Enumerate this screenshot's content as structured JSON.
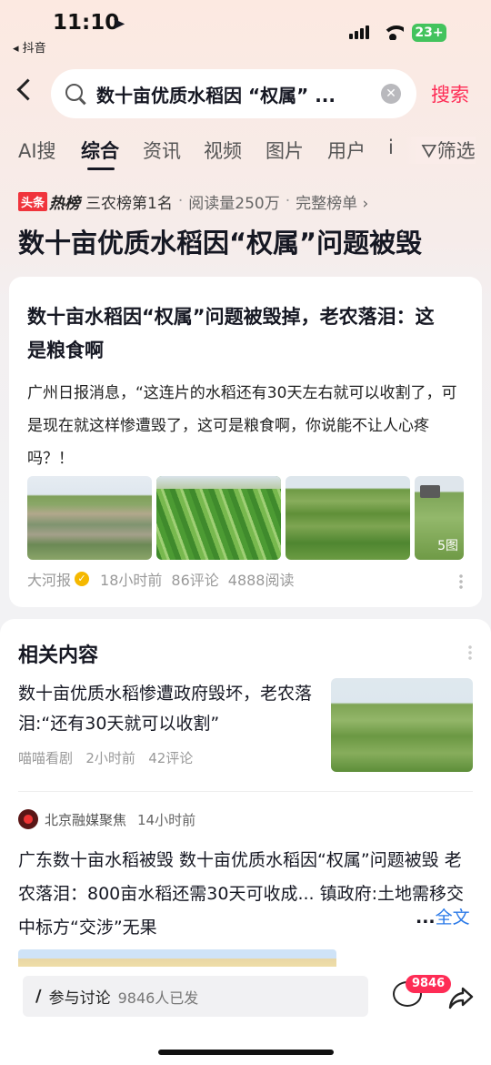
{
  "status": {
    "time": "11:10",
    "back_app": "◂ 抖音",
    "battery": "23+"
  },
  "search": {
    "query": "数十亩优质水稻因 “权属” ...",
    "button": "搜索"
  },
  "tabs": [
    {
      "label": "AI搜"
    },
    {
      "label": "综合"
    },
    {
      "label": "资讯"
    },
    {
      "label": "视频"
    },
    {
      "label": "图片"
    },
    {
      "label": "用户"
    },
    {
      "label": "i"
    }
  ],
  "filter": "筛选",
  "hot": {
    "brand_a": "头条",
    "brand_b": "热榜",
    "rank": "三农榜第1名",
    "reads": "阅读量250万",
    "full": "完整榜单 ›",
    "title": "数十亩优质水稻因“权属”问题被毁"
  },
  "article": {
    "title": "数十亩水稻因“权属”问题被毁掉，老农落泪：这是粮食啊",
    "body": "广州日报消息，“这连片的水稻还有30天左右就可以收割了，可是现在就这样惨遭毁了，这可是粮食啊，你说能不让人心疼吗？！",
    "image_count": "5图",
    "source": "大河报",
    "time": "18小时前",
    "comments": "86评论",
    "reads": "4888阅读"
  },
  "related": {
    "heading": "相关内容",
    "item1": {
      "title": "数十亩优质水稻惨遭政府毁坏，老农落泪:“还有30天就可以收割”",
      "source": "喵喵看剧",
      "time": "2小时前",
      "comments": "42评论"
    },
    "item2": {
      "source": "北京融媒聚焦",
      "time": "14小时前",
      "text": "广东数十亩水稻被毁 数十亩优质水稻因“权属”问题被毁 老农落泪：800亩水稻还需30天可收成... 镇政府:土地需移交中标方“交涉”无果",
      "more_prefix": "...",
      "more": "全文"
    }
  },
  "bottom": {
    "discuss": "参与讨论",
    "discuss_count": "9846人已发",
    "comment_badge": "9846"
  },
  "colors": {
    "accent": "#fe2c55",
    "link": "#2b7ae8"
  }
}
